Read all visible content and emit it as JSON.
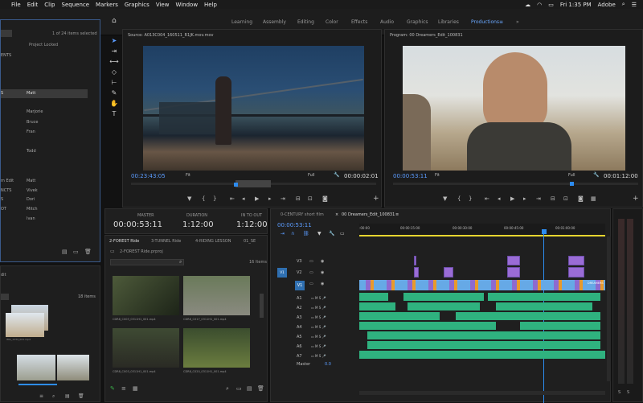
{
  "menubar": {
    "items": [
      "File",
      "Edit",
      "Clip",
      "Sequence",
      "Markers",
      "Graphics",
      "View",
      "Window",
      "Help"
    ],
    "time": "Fri 1:35 PM",
    "app": "Adobe"
  },
  "workspaces": [
    "Learning",
    "Assembly",
    "Editing",
    "Color",
    "Effects",
    "Audio",
    "Graphics",
    "Libraries",
    "Productions",
    "»"
  ],
  "project_panel": {
    "count": "1 of 24 items selected",
    "locked": "Project Locked",
    "rows": [
      {
        "a": "ENTS",
        "b": ""
      },
      {
        "a": "S",
        "b": "Matt"
      },
      {
        "a": "",
        "b": "Marjorie"
      },
      {
        "a": "",
        "b": "Bruce"
      },
      {
        "a": "",
        "b": "Fran"
      },
      {
        "a": "",
        "b": "Todd"
      },
      {
        "a": "m Edit",
        "b": "Matt"
      },
      {
        "a": "NCTS",
        "b": "Vivek"
      },
      {
        "a": "S",
        "b": "Dori"
      },
      {
        "a": "OT",
        "b": "Mitch"
      },
      {
        "a": "",
        "b": "Ivan"
      }
    ]
  },
  "bin_panel": {
    "title": "dit",
    "count": "18 items",
    "thumb_label": "IMG_1234_001.mp4"
  },
  "source_monitor": {
    "title": "Source: A013C004_160511_R1JK.mov.mov",
    "timecode": "00:23:43:05",
    "fit": "Fit",
    "quality": "Full",
    "duration": "00:00:02:01"
  },
  "program_monitor": {
    "title": "Program: 00 Dreamers_Edit_100831",
    "timecode": "00:00:53:11",
    "fit": "Fit",
    "quality": "Full",
    "duration": "00:01:12:00"
  },
  "info": {
    "master_label": "MASTER",
    "master": "00:00:53:11",
    "duration_label": "DURATION",
    "duration": "1:12:00",
    "inout_label": "IN TO OUT",
    "inout": "1:12:00"
  },
  "media_browser": {
    "tabs": [
      "2-FOREST Ride",
      "3-TUNNEL Ride",
      "4-RIDING LESSON",
      "01_SE"
    ],
    "path": "2-FOREST Ride.prproj",
    "items_count": "16 Items",
    "clips": [
      "CDR8_C003_0311H1_001.mp4",
      "CDR8_C017_0311H1_001.mp4",
      "CDR8_C003_0311H1_001.mp4",
      "CDR8_C020_0311H1_001.mp4"
    ]
  },
  "timeline": {
    "tabs": [
      "0-CENTURY short film",
      "00 Dreamers_Edit_100831"
    ],
    "timecode": "00:00:53:11",
    "ruler": [
      ":00:00",
      "00:00:15:00",
      "00:00:30:00",
      "00:00:45:00",
      "00:01:00:00"
    ],
    "video_tracks": [
      "V3",
      "V2",
      "V1"
    ],
    "audio_tracks": [
      "A1",
      "A2",
      "A3",
      "A4",
      "A5",
      "A6",
      "A7"
    ],
    "master": "Master",
    "master_val": "0.0",
    "clip_label": "DREAMERS"
  },
  "colors": {
    "accent": "#2d8cf0",
    "audio": "#2fb27f",
    "video": "#9a6cd6",
    "video_alt": "#66a9e6",
    "orange": "#e89a2c",
    "yellow": "#e6d52f"
  }
}
